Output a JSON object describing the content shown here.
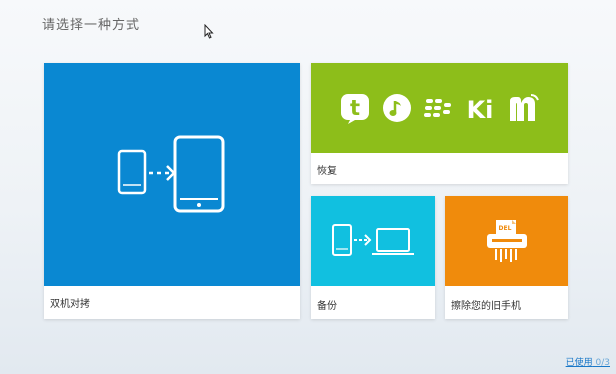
{
  "page": {
    "title": "请选择一种方式"
  },
  "tiles": [
    {
      "label": "双机对拷",
      "color": "#0a88d2"
    },
    {
      "label": "恢复",
      "color": "#8dbe1a",
      "icons": [
        "t",
        "♫",
        "✥",
        "Ki",
        "m"
      ]
    },
    {
      "label": "备份",
      "color": "#11c0e0"
    },
    {
      "label": "擦除您的旧手机",
      "color": "#f08b0c",
      "icon_text": "DEL"
    }
  ],
  "footer": {
    "usage_label": "已使用",
    "usage_count": "0/3"
  }
}
